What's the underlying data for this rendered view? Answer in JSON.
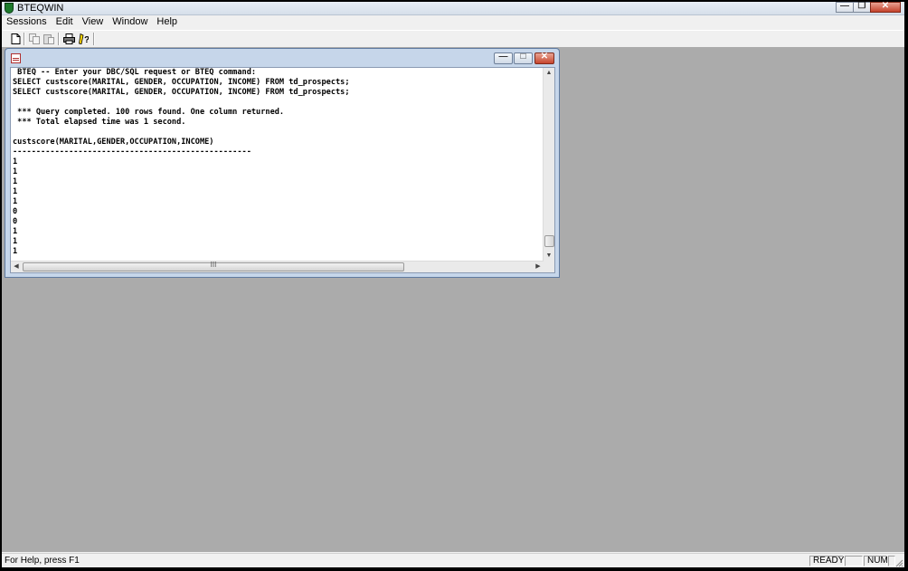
{
  "app": {
    "title": "BTEQWIN"
  },
  "menu": [
    "Sessions",
    "Edit",
    "View",
    "Window",
    "Help"
  ],
  "toolbar": {
    "icons": [
      "new-document-icon",
      "copy-icon",
      "paste-icon",
      "print-icon",
      "help-icon"
    ]
  },
  "child": {
    "console_lines": [
      " BTEQ -- Enter your DBC/SQL request or BTEQ command:",
      "SELECT custscore(MARITAL, GENDER, OCCUPATION, INCOME) FROM td_prospects;",
      "SELECT custscore(MARITAL, GENDER, OCCUPATION, INCOME) FROM td_prospects;",
      "",
      " *** Query completed. 100 rows found. One column returned.",
      " *** Total elapsed time was 1 second.",
      "",
      "custscore(MARITAL,GENDER,OCCUPATION,INCOME)",
      "---------------------------------------------------",
      "1",
      "1",
      "1",
      "1",
      "1",
      "0",
      "0",
      "1",
      "1",
      "1"
    ],
    "hscroll_grip": "III"
  },
  "statusbar": {
    "help_text": "For Help, press F1",
    "ready": "READY",
    "num": "NUM"
  },
  "colors": {
    "workspace": "#ababab",
    "child_frame": "#c6d6ea",
    "close_button": "#c4422b"
  }
}
